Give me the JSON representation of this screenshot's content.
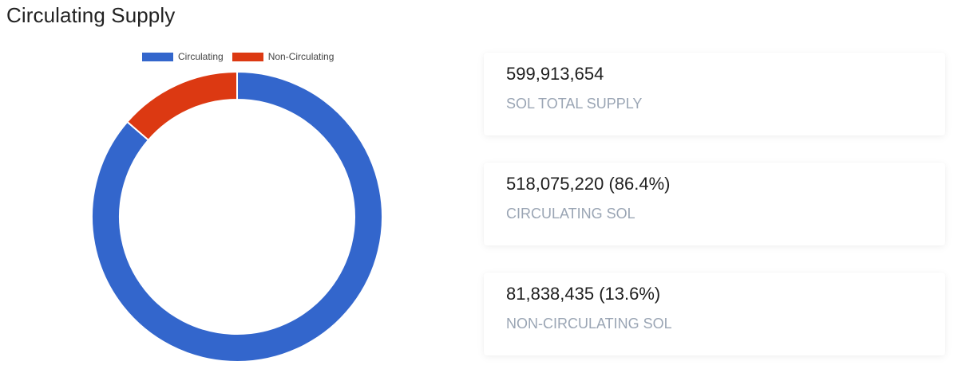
{
  "title": "Circulating Supply",
  "chart_data": {
    "type": "pie",
    "title": "",
    "categories": [
      "Circulating",
      "Non-Circulating"
    ],
    "values": [
      518075220,
      81838435
    ],
    "colors": [
      "#3366CC",
      "#DC3912"
    ],
    "legend_position": "top",
    "donut": true
  },
  "legend": [
    {
      "label": "Circulating",
      "color": "#3366CC"
    },
    {
      "label": "Non-Circulating",
      "color": "#DC3912"
    }
  ],
  "stats": [
    {
      "value": "599,913,654",
      "label": "SOL TOTAL SUPPLY"
    },
    {
      "value": "518,075,220 (86.4%)",
      "label": "CIRCULATING SOL"
    },
    {
      "value": "81,838,435 (13.6%)",
      "label": "NON-CIRCULATING SOL"
    }
  ]
}
